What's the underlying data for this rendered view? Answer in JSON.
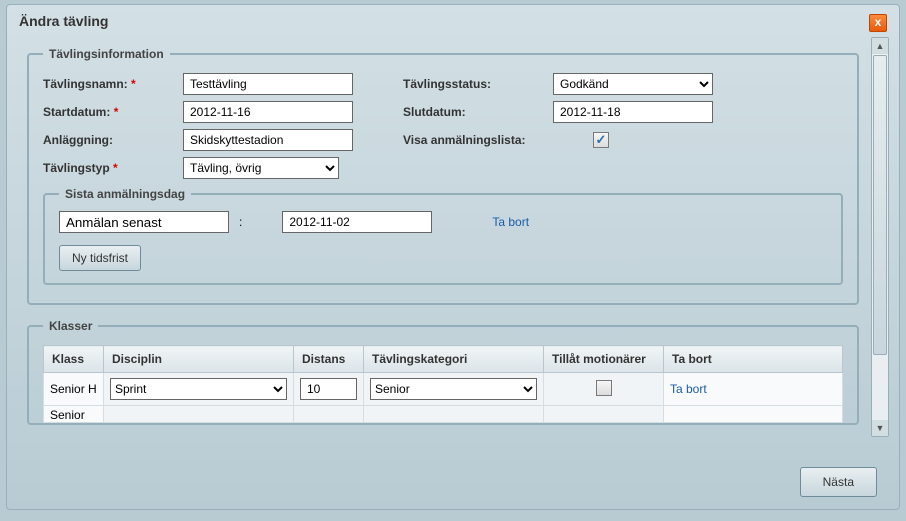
{
  "dialog": {
    "title": "Ändra tävling",
    "close_glyph": "x"
  },
  "section_info": {
    "legend": "Tävlingsinformation",
    "name_label": "Tävlingsnamn:",
    "name_value": "Testtävling",
    "status_label": "Tävlingsstatus:",
    "status_value": "Godkänd",
    "start_label": "Startdatum:",
    "start_value": "2012-11-16",
    "end_label": "Slutdatum:",
    "end_value": "2012-11-18",
    "venue_label": "Anläggning:",
    "venue_value": "Skidskyttestadion",
    "showlist_label": "Visa anmälningslista:",
    "showlist_checked": true,
    "type_label": "Tävlingstyp",
    "type_value": "Tävling, övrig",
    "required_mark": "*"
  },
  "deadline": {
    "legend": "Sista anmälningsdag",
    "name_value": "Anmälan senast",
    "colon": ":",
    "date_value": "2012-11-02",
    "remove_link": "Ta bort",
    "new_button": "Ny tidsfrist"
  },
  "section_classes": {
    "legend": "Klasser",
    "columns": {
      "klass": "Klass",
      "disciplin": "Disciplin",
      "distans": "Distans",
      "kategori": "Tävlingskategori",
      "motionarer": "Tillåt motionärer",
      "tabort": "Ta bort"
    },
    "rows": [
      {
        "klass": "Senior H",
        "disciplin": "Sprint",
        "distans": "10",
        "kategori": "Senior",
        "motionarer": false,
        "tabort": "Ta bort"
      },
      {
        "klass": "Senior",
        "disciplin": "",
        "distans": "",
        "kategori": "",
        "motionarer": false,
        "tabort": ""
      }
    ]
  },
  "footer": {
    "next": "Nästa"
  }
}
